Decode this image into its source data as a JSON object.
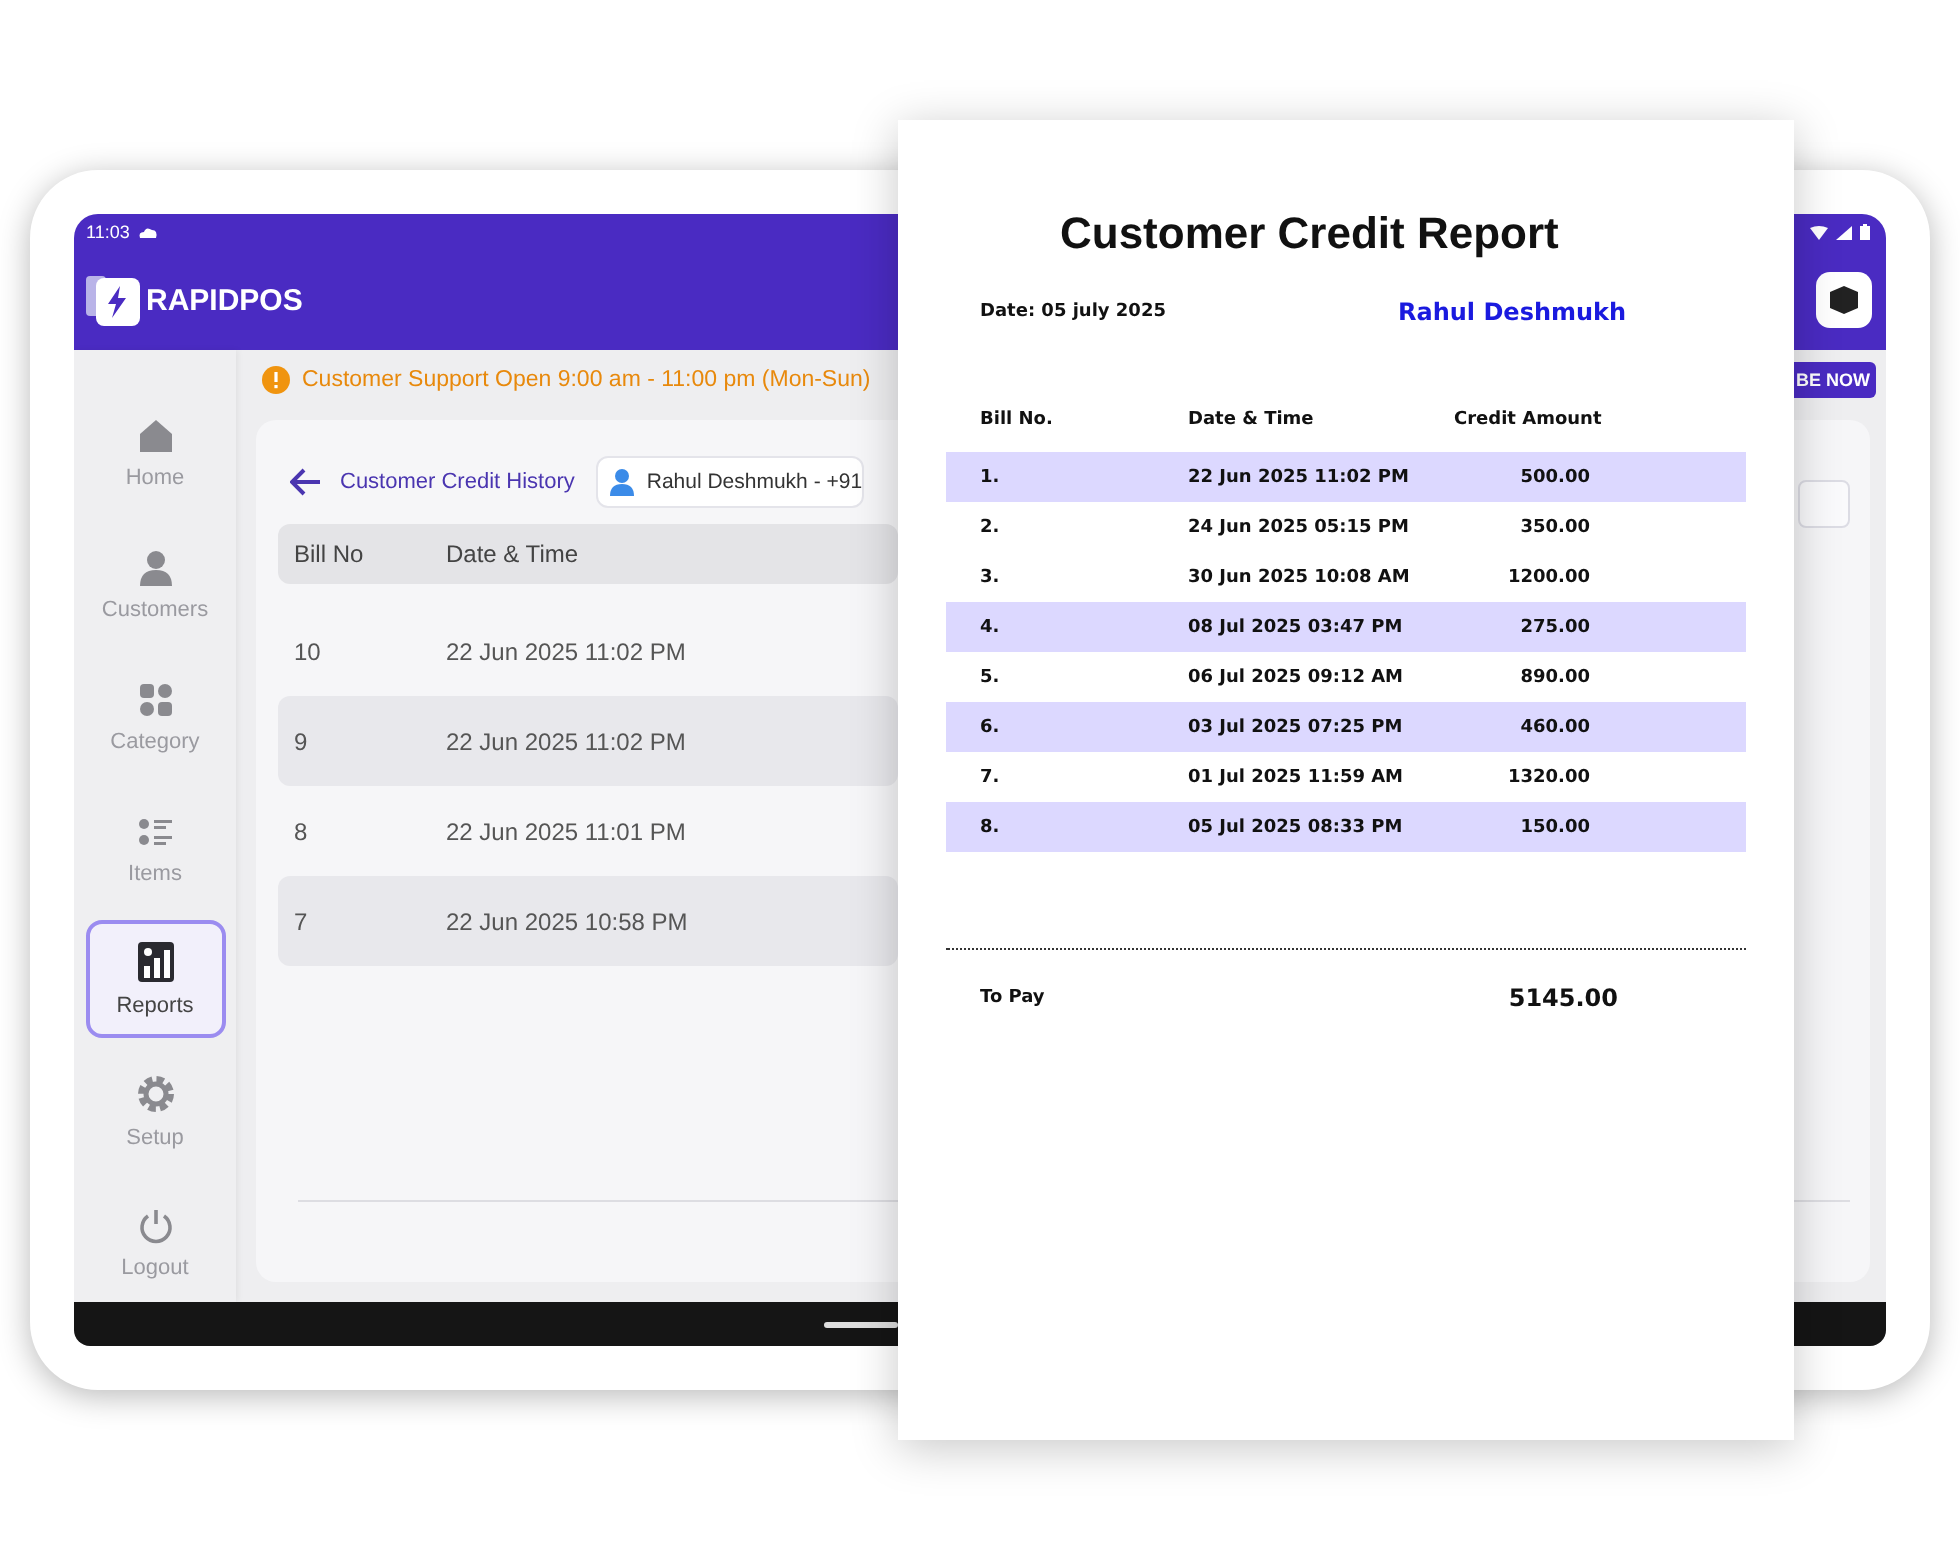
{
  "status_bar": {
    "time": "11:03"
  },
  "header": {
    "brand": "RAPIDPOS"
  },
  "sidebar": {
    "items": [
      {
        "label": "Home",
        "kind": "home",
        "selected": false
      },
      {
        "label": "Customers",
        "kind": "person",
        "selected": false
      },
      {
        "label": "Category",
        "kind": "grid",
        "selected": false
      },
      {
        "label": "Items",
        "kind": "list",
        "selected": false
      },
      {
        "label": "Reports",
        "kind": "report",
        "selected": true
      },
      {
        "label": "Setup",
        "kind": "gear",
        "selected": false
      },
      {
        "label": "Logout",
        "kind": "power",
        "selected": false
      }
    ]
  },
  "banner": {
    "text": "Customer Support Open 9:00 am - 11:00 pm (Mon-Sun)",
    "button": "BE NOW"
  },
  "credit_history": {
    "title": "Customer Credit History",
    "customer": "Rahul Deshmukh - +91",
    "columns": [
      "Bill No",
      "Date & Time"
    ],
    "rows": [
      {
        "bill": "10",
        "date": "22 Jun 2025 11:02 PM"
      },
      {
        "bill": "9",
        "date": "22 Jun 2025 11:02 PM"
      },
      {
        "bill": "8",
        "date": "22 Jun 2025 11:01 PM"
      },
      {
        "bill": "7",
        "date": "22 Jun 2025 10:58 PM"
      }
    ]
  },
  "report": {
    "title": "Customer Credit Report",
    "date": "Date: 05 july 2025",
    "customer": "Rahul Deshmukh",
    "columns": [
      "Bill No.",
      "Date & Time",
      "Credit Amount"
    ],
    "rows": [
      {
        "bill": "1.",
        "date": "22 Jun 2025 11:02 PM",
        "amount": "500.00",
        "highlighted": true
      },
      {
        "bill": "2.",
        "date": "24 Jun 2025 05:15 PM",
        "amount": "350.00",
        "highlighted": false
      },
      {
        "bill": "3.",
        "date": "30 Jun 2025 10:08 AM",
        "amount": "1200.00",
        "highlighted": false
      },
      {
        "bill": "4.",
        "date": "08 Jul 2025 03:47 PM",
        "amount": "275.00",
        "highlighted": true
      },
      {
        "bill": "5.",
        "date": "06 Jul 2025 09:12 AM",
        "amount": "890.00",
        "highlighted": false
      },
      {
        "bill": "6.",
        "date": "03 Jul 2025 07:25 PM",
        "amount": "460.00",
        "highlighted": true
      },
      {
        "bill": "7.",
        "date": "01 Jul 2025 11:59 AM",
        "amount": "1320.00",
        "highlighted": false
      },
      {
        "bill": "8.",
        "date": "05 Jul 2025 08:33 PM",
        "amount": "150.00",
        "highlighted": true
      }
    ],
    "total_label": "To Pay",
    "total": "5145.00"
  }
}
